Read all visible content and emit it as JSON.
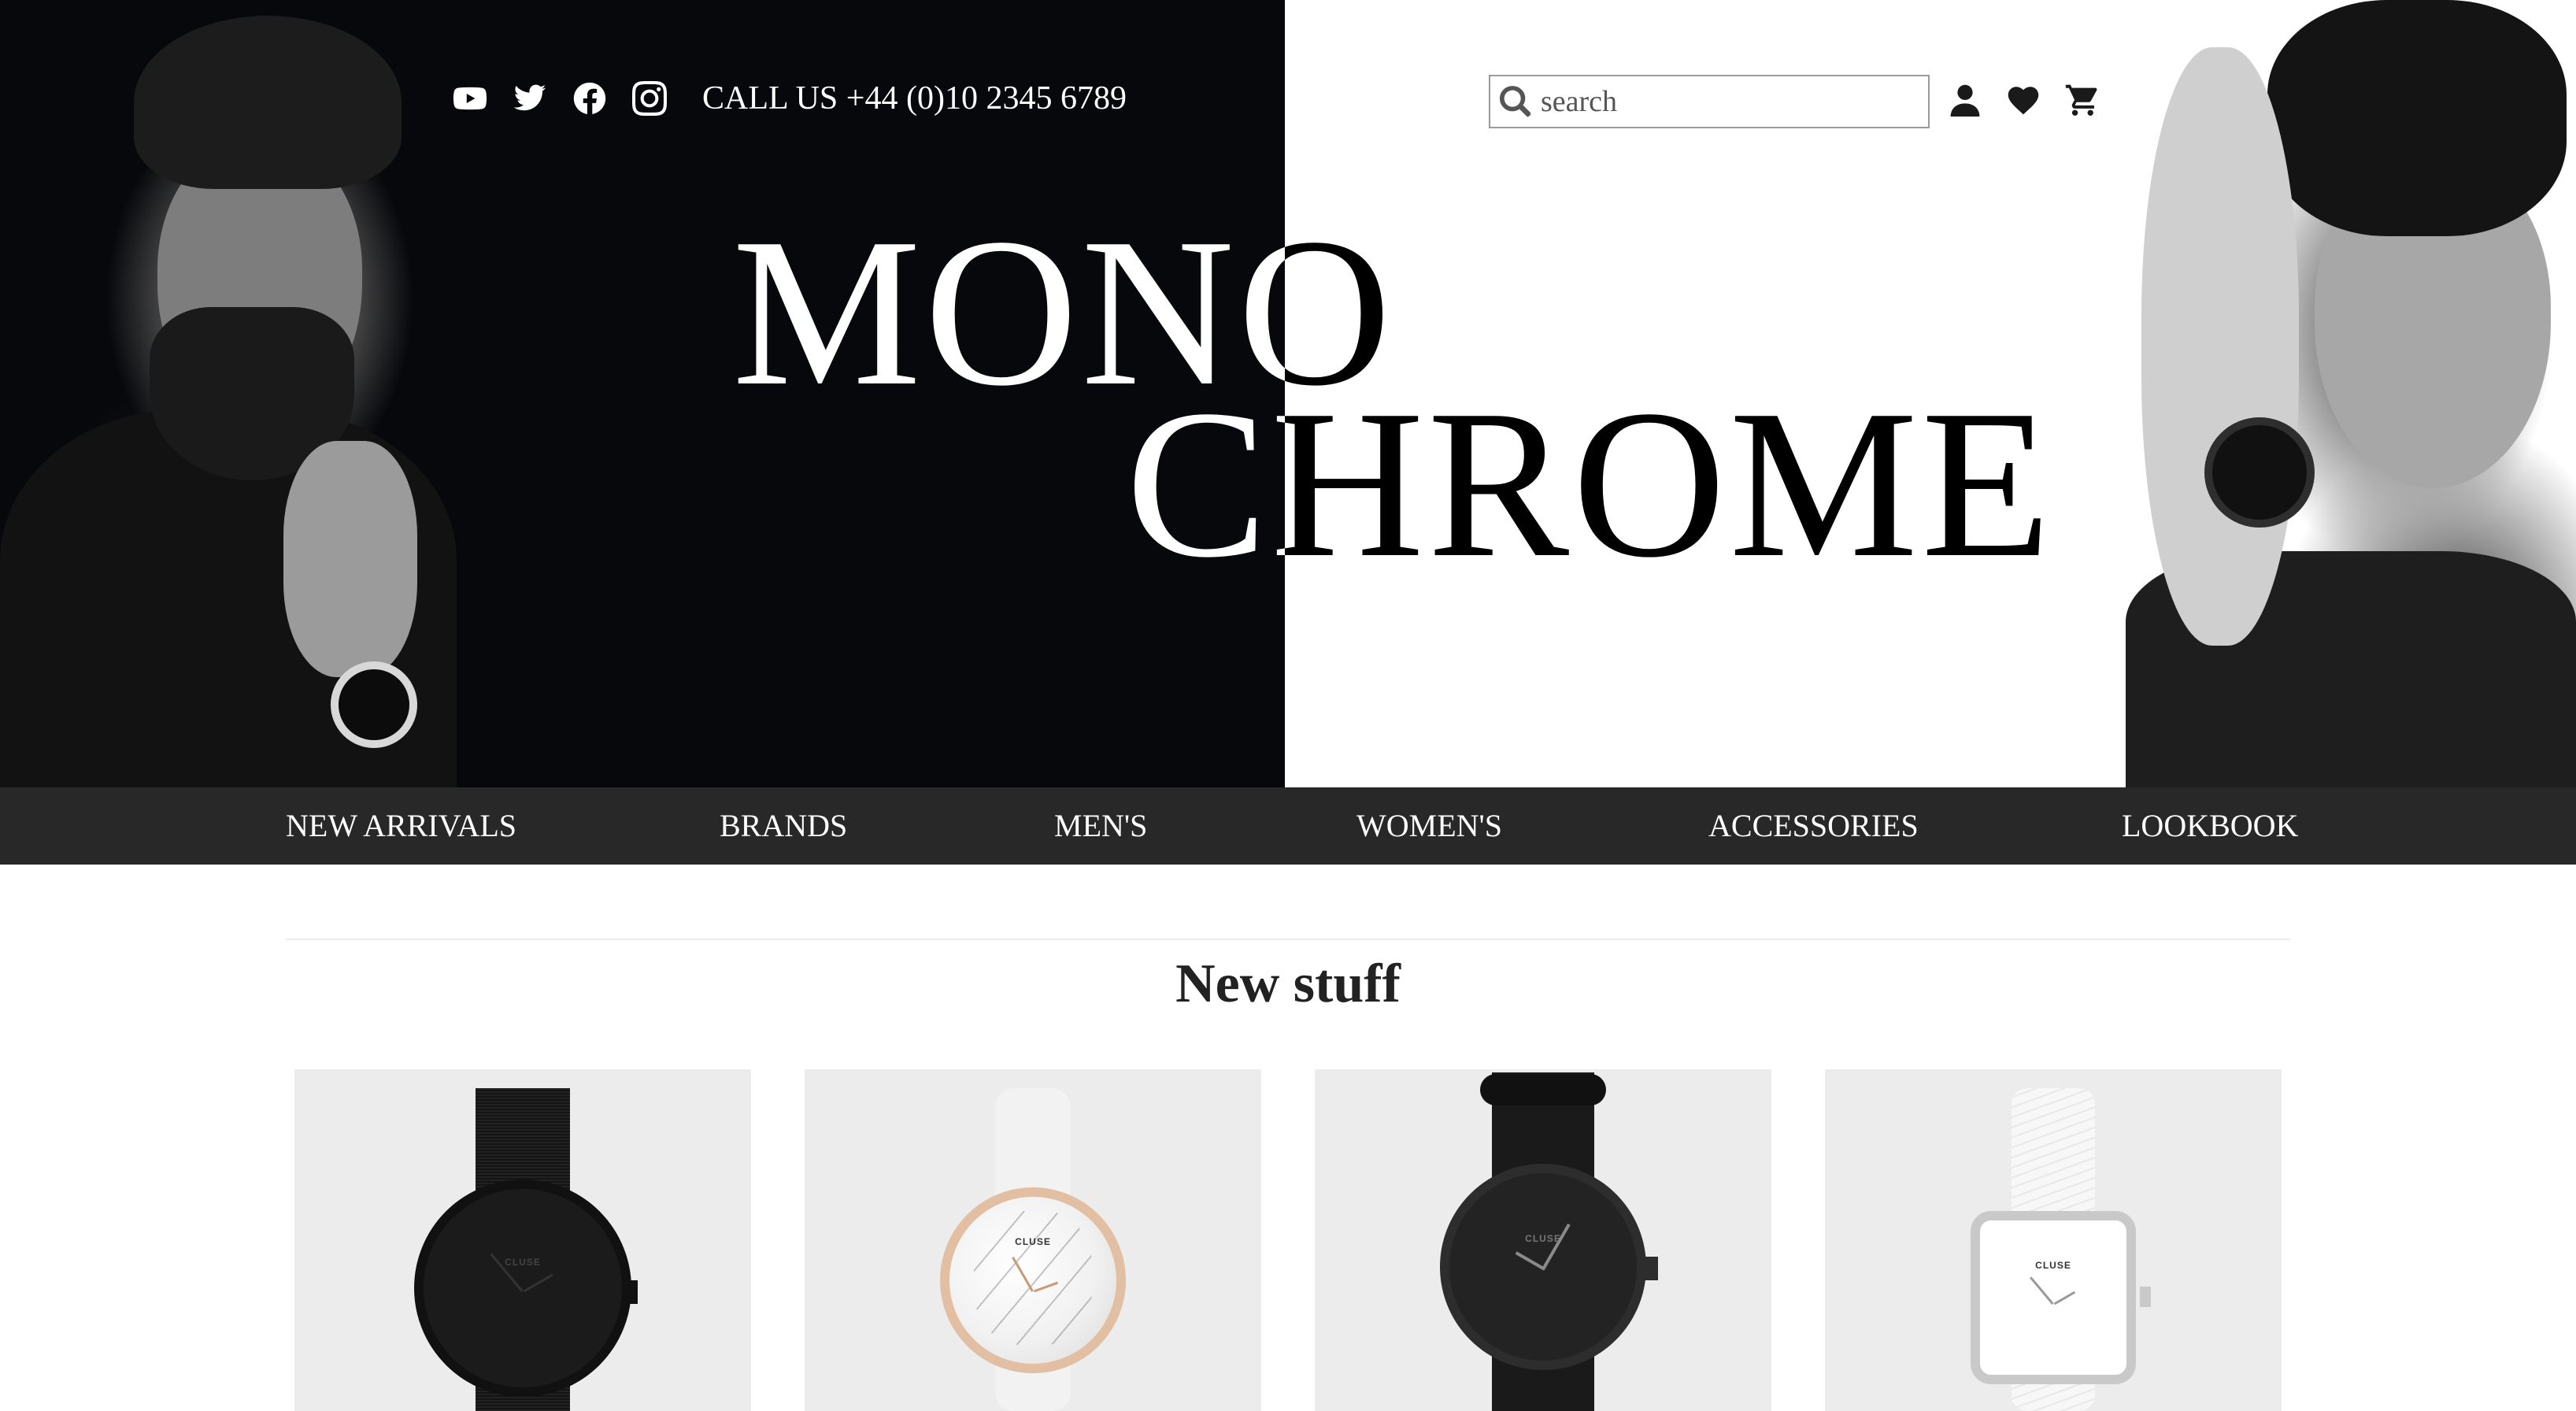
{
  "hero": {
    "logo_line1": "MONO",
    "logo_line2": "CHROME",
    "colors": {
      "left_bg": "#07080b",
      "right_bg": "#ffffff"
    }
  },
  "social": {
    "icons": [
      "youtube-icon",
      "twitter-icon",
      "facebook-icon",
      "instagram-icon"
    ],
    "phone": "CALL US +44 (0)10 2345 6789"
  },
  "search": {
    "placeholder": "search",
    "value": ""
  },
  "user_icons": [
    "user-icon",
    "heart-icon",
    "cart-icon"
  ],
  "nav": {
    "items": [
      "NEW ARRIVALS",
      "BRANDS",
      "MEN'S",
      "WOMEN'S",
      "ACCESSORIES",
      "LOOKBOOK"
    ],
    "bg_color": "#282828"
  },
  "section": {
    "title": "New stuff"
  },
  "products": [
    {
      "brand": "CLUSE",
      "style": "black-mesh-round"
    },
    {
      "brand": "CLUSE",
      "style": "white-marble-rose-gold"
    },
    {
      "brand": "CLUSE",
      "style": "black-nato-round"
    },
    {
      "brand": "CLUSE",
      "style": "white-square-silver"
    }
  ]
}
